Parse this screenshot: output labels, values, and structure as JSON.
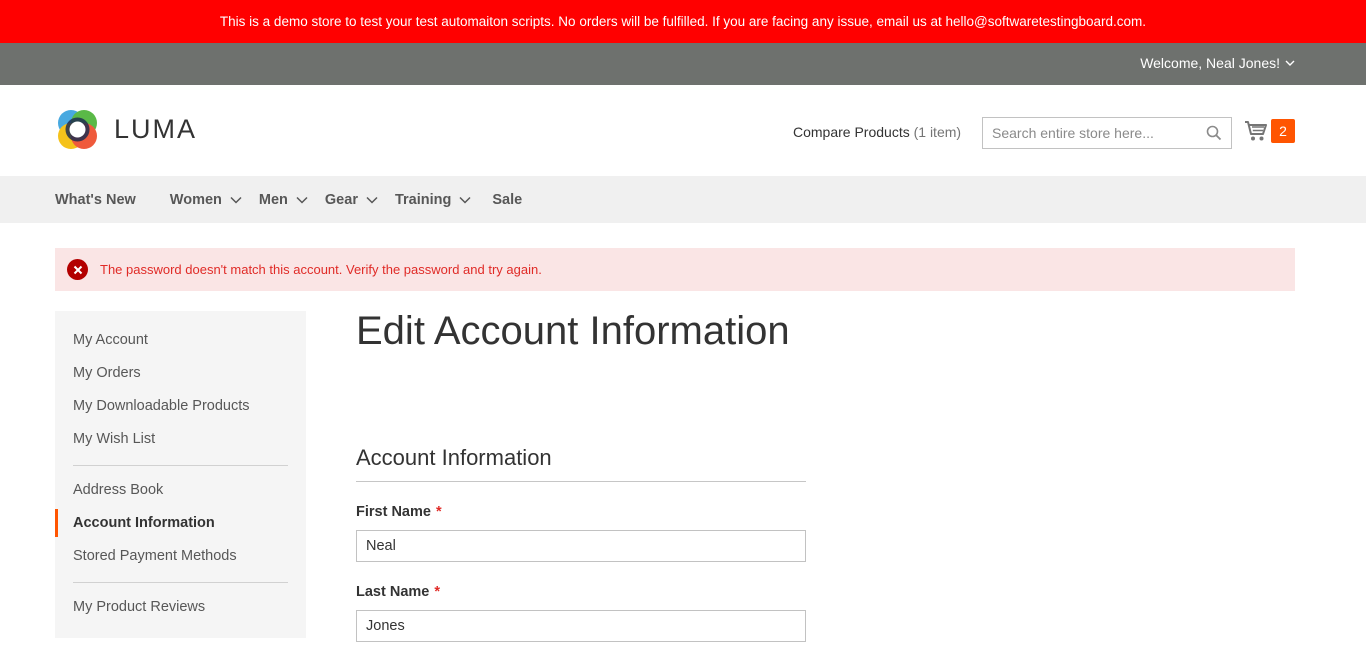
{
  "banner": {
    "text": "This is a demo store to test your test automaiton scripts. No orders will be fulfilled. If you are facing any issue, email us at hello@softwaretestingboard.com."
  },
  "panel": {
    "welcome": "Welcome, Neal Jones!"
  },
  "header": {
    "logo_text": "LUMA",
    "compare_label": "Compare Products",
    "compare_count": "(1 item)",
    "search_placeholder": "Search entire store here...",
    "cart_count": "2"
  },
  "nav": {
    "items": [
      {
        "label": "What's New",
        "has_dropdown": false
      },
      {
        "label": "Women",
        "has_dropdown": true
      },
      {
        "label": "Men",
        "has_dropdown": true
      },
      {
        "label": "Gear",
        "has_dropdown": true
      },
      {
        "label": "Training",
        "has_dropdown": true
      },
      {
        "label": "Sale",
        "has_dropdown": false
      }
    ]
  },
  "message": {
    "error": "The password doesn't match this account. Verify the password and try again."
  },
  "sidebar": {
    "items": [
      {
        "label": "My Account"
      },
      {
        "label": "My Orders"
      },
      {
        "label": "My Downloadable Products"
      },
      {
        "label": "My Wish List"
      },
      {
        "label": "Address Book"
      },
      {
        "label": "Account Information",
        "active": true
      },
      {
        "label": "Stored Payment Methods"
      },
      {
        "label": "My Product Reviews"
      }
    ]
  },
  "main": {
    "title": "Edit Account Information",
    "section_title": "Account Information",
    "fields": {
      "first_name": {
        "label": "First Name",
        "value": "Neal",
        "required_mark": "*"
      },
      "last_name": {
        "label": "Last Name",
        "value": "Jones",
        "required_mark": "*"
      }
    }
  },
  "colors": {
    "banner_bg": "#ff0000",
    "panel_bg": "#6e716e",
    "accent": "#ff5501",
    "error_bg": "#fae5e5",
    "error_text": "#e02b27"
  }
}
